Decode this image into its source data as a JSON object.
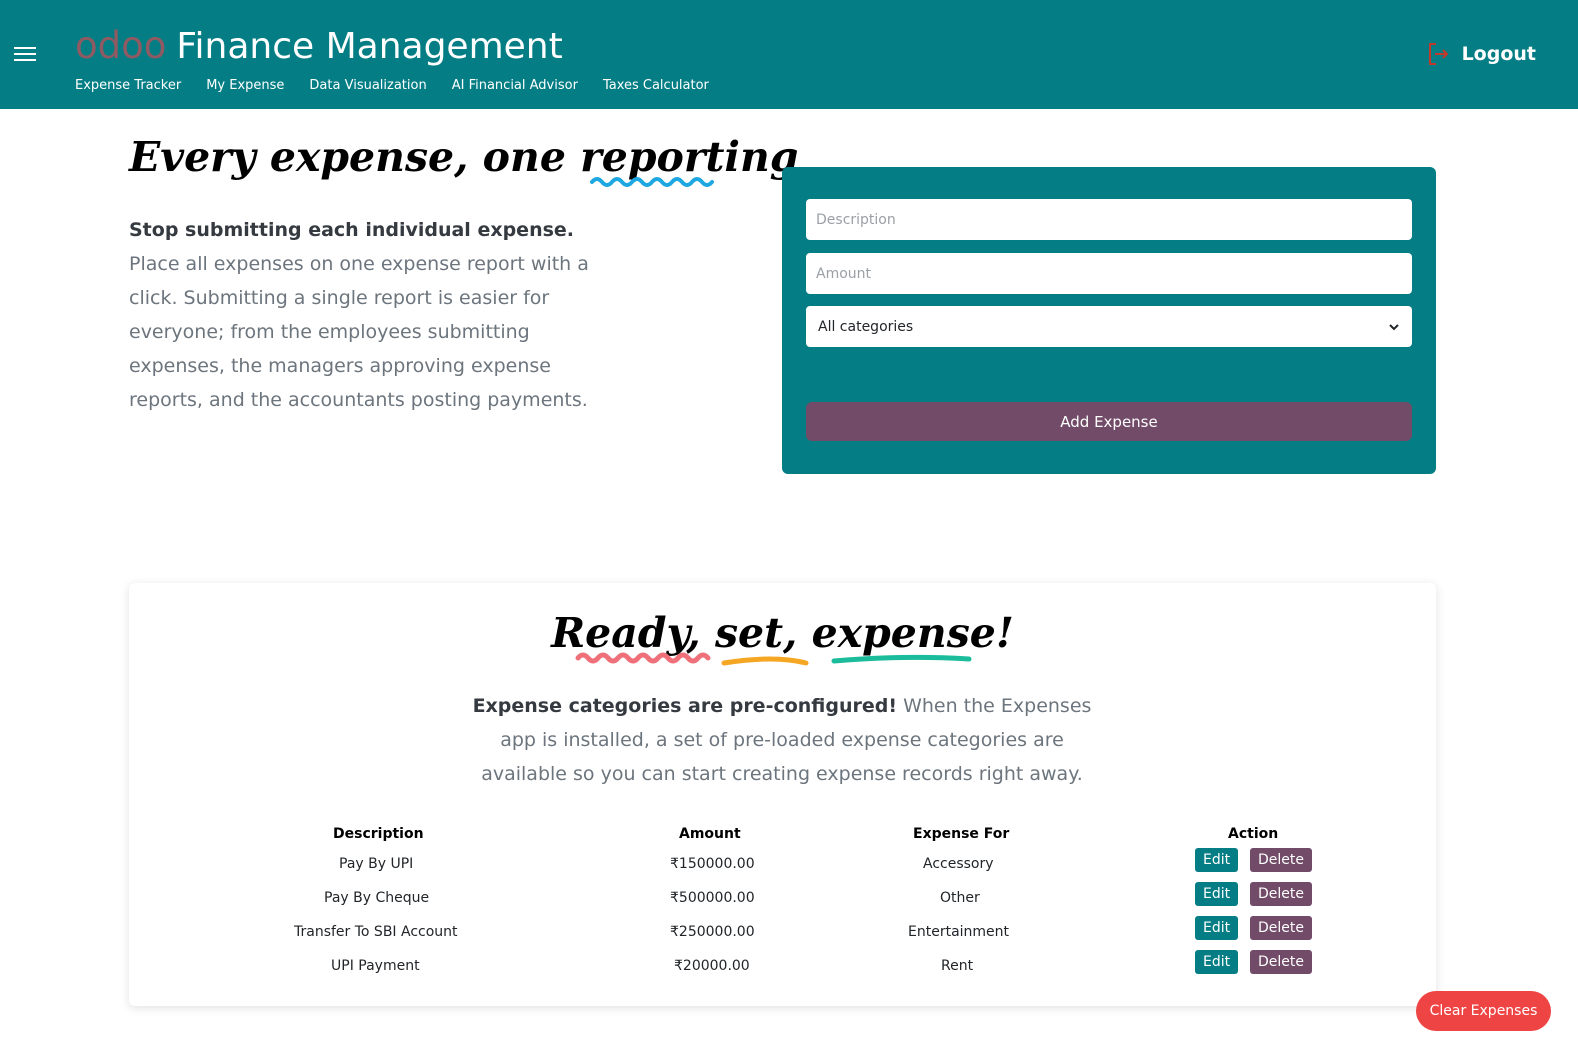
{
  "header": {
    "logo_text": "odoo",
    "title": "Finance Management",
    "nav": [
      "Expense Tracker",
      "My Expense",
      "Data Visualization",
      "AI Financial Advisor",
      "Taxes Calculator"
    ],
    "logout_label": "Logout"
  },
  "hero": {
    "title": "Every expense, one reporting",
    "lead_bold": "Stop submitting each individual expense.",
    "lead_rest": " Place all expenses on one expense report with a click. Submitting a single report is easier for everyone; from the employees submitting expenses, the managers approving expense reports, and the accountants posting payments."
  },
  "form": {
    "description_placeholder": "Description",
    "amount_placeholder": "Amount",
    "category_selected": "All categories",
    "submit_label": "Add Expense"
  },
  "panel": {
    "title": "Ready, set, expense!",
    "text_bold": "Expense categories are pre-configured!",
    "text_rest": " When the Expenses app is installed, a set of pre-loaded expense categories are available so you can start creating expense records right away."
  },
  "table": {
    "headers": [
      "Description",
      "Amount",
      "Expense For",
      "Action"
    ],
    "rows": [
      {
        "description": "Pay By UPI",
        "amount": "₹150000.00",
        "expense_for": "Accessory"
      },
      {
        "description": "Pay By Cheque",
        "amount": "₹500000.00",
        "expense_for": "Other"
      },
      {
        "description": "Transfer To SBI Account",
        "amount": "₹250000.00",
        "expense_for": "Entertainment"
      },
      {
        "description": "UPI Payment",
        "amount": "₹20000.00",
        "expense_for": "Rent"
      }
    ],
    "edit_label": "Edit",
    "delete_label": "Delete"
  },
  "clear_label": "Clear Expenses",
  "colors": {
    "teal": "#047e84",
    "plum": "#714b67",
    "red": "#ef4444"
  }
}
